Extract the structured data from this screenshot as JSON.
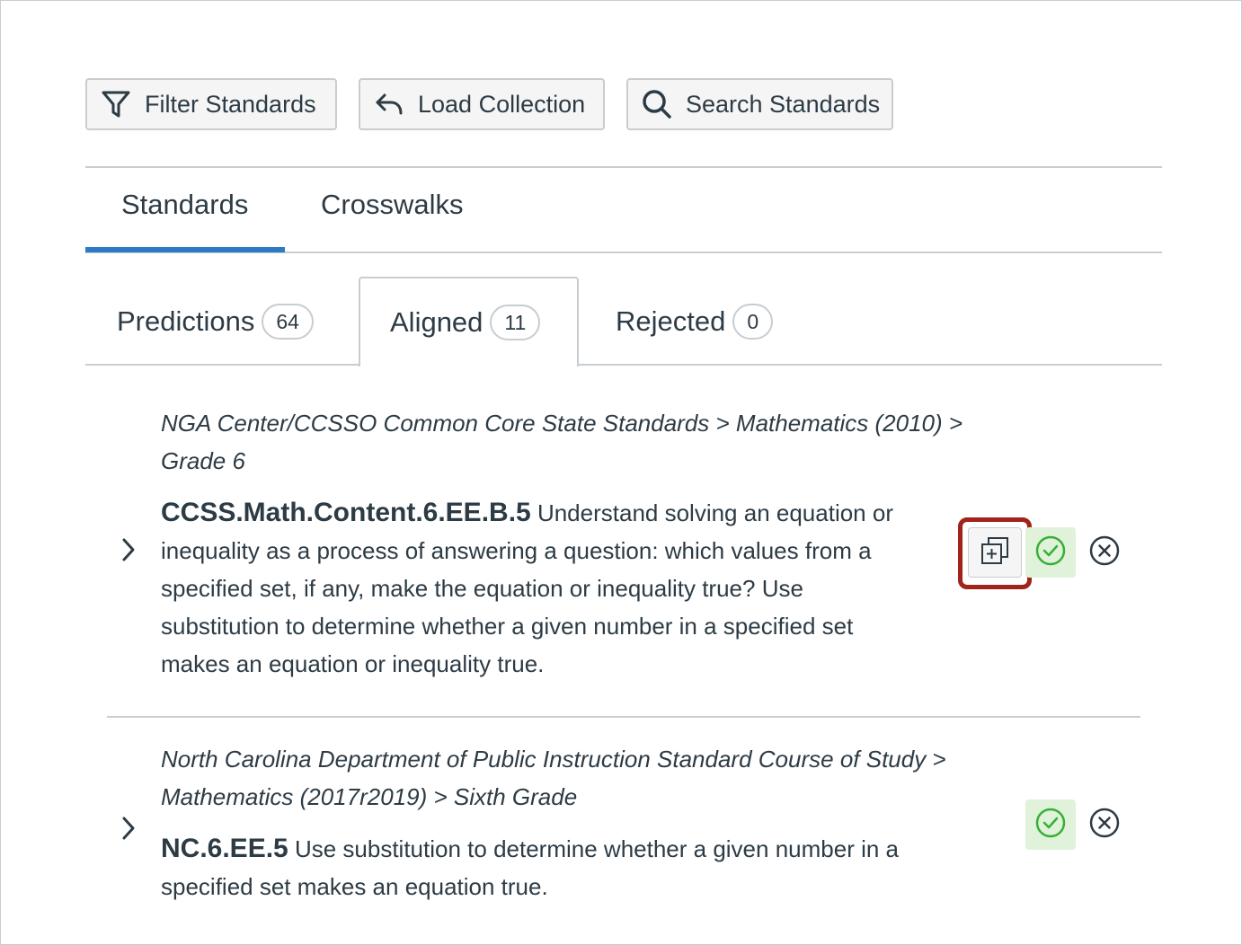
{
  "toolbar": {
    "filter_label": "Filter Standards",
    "load_label": "Load Collection",
    "search_label": "Search Standards"
  },
  "tabs": {
    "standards": "Standards",
    "crosswalks": "Crosswalks"
  },
  "subtabs": {
    "predictions": {
      "label": "Predictions",
      "count": "64"
    },
    "aligned": {
      "label": "Aligned",
      "count": "11"
    },
    "rejected": {
      "label": "Rejected",
      "count": "0"
    }
  },
  "items": [
    {
      "path_line1": "NGA Center/CCSSO Common Core State Standards > Mathematics (2010) >",
      "path_line2": "Grade 6",
      "code": "CCSS.Math.Content.6.EE.B.5",
      "desc_line1": " Understand solving an equation or",
      "desc_line2": "inequality as a process of answering a question: which values from a",
      "desc_line3": "specified set, if any, make the equation or inequality true? Use",
      "desc_line4": "substitution to determine whether a given number in a specified set",
      "desc_line5": "makes an equation or inequality true."
    },
    {
      "path_line1": "North Carolina Department of Public Instruction Standard Course of Study >",
      "path_line2": "Mathematics (2017r2019) > Sixth Grade",
      "code": "NC.6.EE.5",
      "desc_line1": " Use substitution to determine whether a given number in a",
      "desc_line2": "specified set makes an equation true."
    }
  ],
  "colors": {
    "tab_indicator": "#2d7bc4",
    "highlight_border": "#a1241a",
    "accept_green": "#36b037",
    "accept_bg": "#e0f2da"
  },
  "icons": [
    "filter-icon",
    "undo-arrow-icon",
    "search-icon",
    "chevron-right-icon",
    "copy-add-icon",
    "check-circle-icon",
    "x-circle-icon"
  ]
}
